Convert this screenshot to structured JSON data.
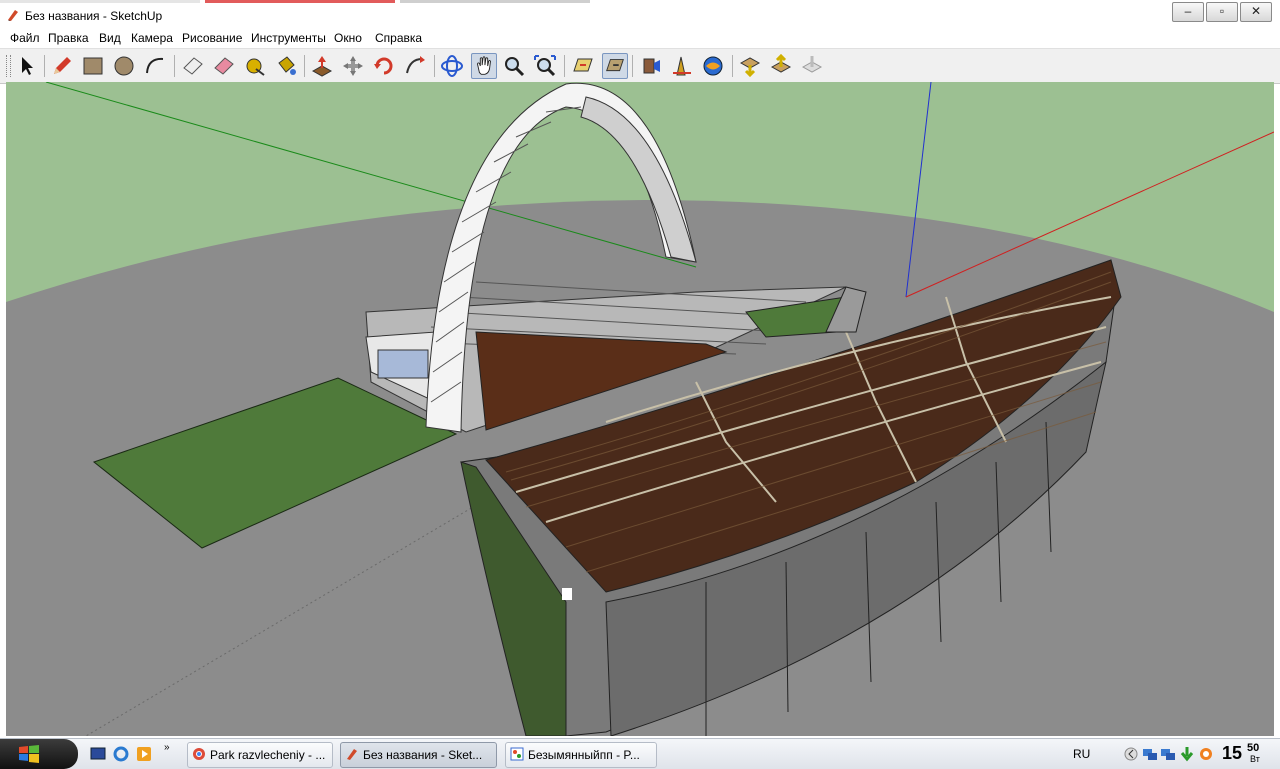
{
  "window": {
    "title": "Без названия - SketchUp"
  },
  "menu": {
    "items": [
      "Файл",
      "Правка",
      "Вид",
      "Камера",
      "Рисование",
      "Инструменты",
      "Окно",
      "Справка"
    ]
  },
  "toolbar": {
    "tools": [
      "select-icon",
      "pencil-icon",
      "rectangle-icon",
      "circle-icon",
      "arc-icon",
      "eraser-icon",
      "paint-bucket-icon",
      "tape-measure-icon",
      "push-pull-icon",
      "move-icon",
      "rotate-icon",
      "follow-me-icon",
      "orbit-icon",
      "pan-icon",
      "zoom-icon",
      "zoom-extents-icon",
      "section-plane-icon",
      "walk-icon",
      "position-camera-icon",
      "look-around-icon",
      "get-models-icon",
      "share-model-icon",
      "share-component-icon",
      "upload-icon",
      "download-icon"
    ]
  },
  "taskbar": {
    "items": [
      {
        "label": "Park razvlecheniy - ..."
      },
      {
        "label": "Без названия - Sket..."
      },
      {
        "label": "Безымянныйпп - P..."
      }
    ],
    "language": "RU",
    "clock_hour": "15",
    "clock_minute": "50",
    "clock_day": "Вт"
  },
  "colors": {
    "sky": "#9cc092",
    "ground": "#8c8c8c",
    "seats": "#4a2a1a",
    "grass": "#4f7a3a"
  }
}
